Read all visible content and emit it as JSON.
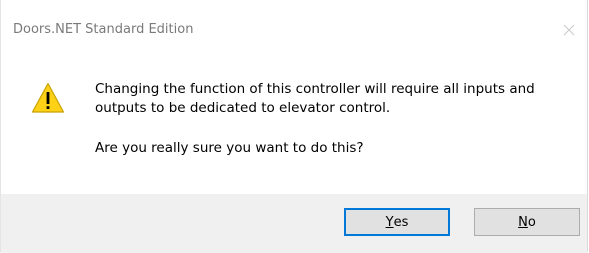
{
  "window": {
    "title": "Doors.NET Standard Edition"
  },
  "message": {
    "line1": "Changing the function of this controller will require all inputs and",
    "line2": "outputs to be dedicated to elevator control.",
    "question": "Are you really sure you want to do this?"
  },
  "icon": "warning-icon",
  "buttons": {
    "yes": {
      "mnemonic": "Y",
      "rest": "es"
    },
    "no": {
      "mnemonic": "N",
      "rest": "o"
    }
  },
  "colors": {
    "warning_fill": "#fcd116",
    "warning_border": "#c9a100",
    "footer_bg": "#f0f0f0",
    "default_button_border": "#0078d7"
  }
}
